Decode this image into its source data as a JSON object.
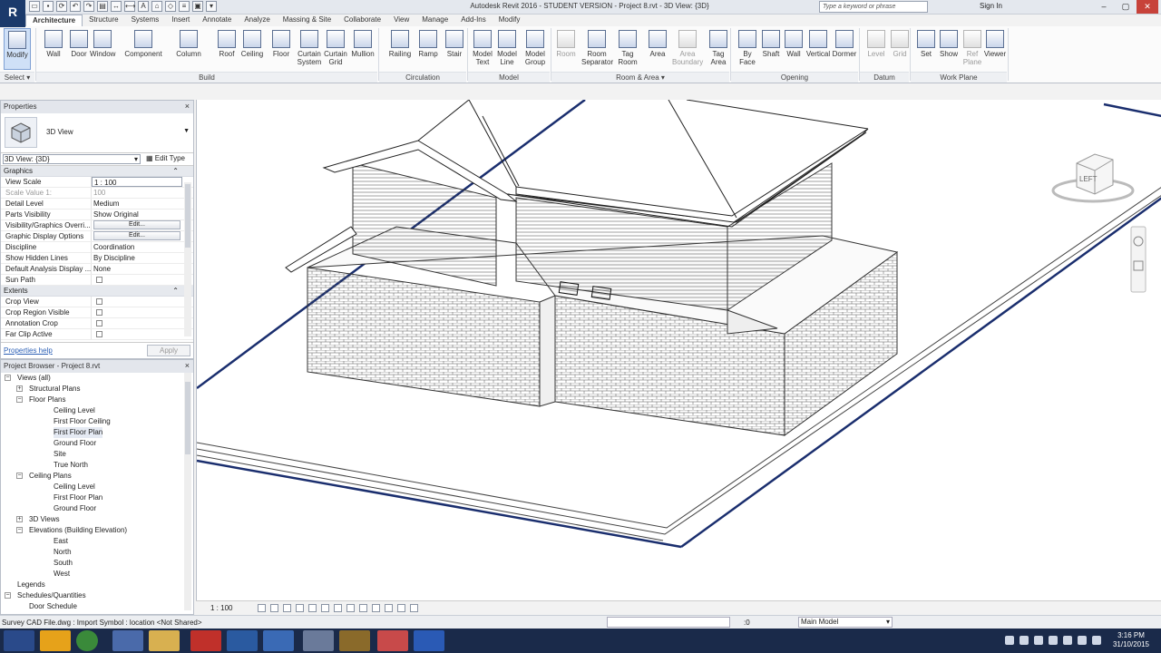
{
  "title": {
    "app_title": "Autodesk Revit 2016 - STUDENT VERSION - Project 8.rvt - 3D View: {3D}",
    "logo": "R",
    "search_placeholder": "Type a keyword or phrase",
    "sign_in": "Sign In"
  },
  "tabs": [
    "Architecture",
    "Structure",
    "Systems",
    "Insert",
    "Annotate",
    "Analyze",
    "Massing & Site",
    "Collaborate",
    "View",
    "Manage",
    "Add-Ins",
    "Modify"
  ],
  "ribbon": {
    "buttons": [
      {
        "id": "modify",
        "l1": "Modify",
        "l2": ""
      },
      {
        "id": "wall",
        "l1": "Wall",
        "l2": ""
      },
      {
        "id": "door",
        "l1": "Door",
        "l2": ""
      },
      {
        "id": "window",
        "l1": "Window",
        "l2": ""
      },
      {
        "id": "component",
        "l1": "Component",
        "l2": ""
      },
      {
        "id": "column",
        "l1": "Column",
        "l2": ""
      },
      {
        "id": "roof",
        "l1": "Roof",
        "l2": ""
      },
      {
        "id": "ceiling",
        "l1": "Ceiling",
        "l2": ""
      },
      {
        "id": "floor",
        "l1": "Floor",
        "l2": ""
      },
      {
        "id": "curtain-system",
        "l1": "Curtain",
        "l2": "System"
      },
      {
        "id": "curtain-grid",
        "l1": "Curtain",
        "l2": "Grid"
      },
      {
        "id": "mullion",
        "l1": "Mullion",
        "l2": ""
      },
      {
        "id": "railing",
        "l1": "Railing",
        "l2": ""
      },
      {
        "id": "ramp",
        "l1": "Ramp",
        "l2": ""
      },
      {
        "id": "stair",
        "l1": "Stair",
        "l2": ""
      },
      {
        "id": "model-text",
        "l1": "Model",
        "l2": "Text"
      },
      {
        "id": "model-line",
        "l1": "Model",
        "l2": "Line"
      },
      {
        "id": "model-group",
        "l1": "Model",
        "l2": "Group"
      },
      {
        "id": "room",
        "l1": "Room",
        "l2": ""
      },
      {
        "id": "room-separator",
        "l1": "Room",
        "l2": "Separator"
      },
      {
        "id": "tag-room",
        "l1": "Tag",
        "l2": "Room"
      },
      {
        "id": "area",
        "l1": "Area",
        "l2": ""
      },
      {
        "id": "area-boundary",
        "l1": "Area",
        "l2": "Boundary"
      },
      {
        "id": "tag-area",
        "l1": "Tag",
        "l2": "Area"
      },
      {
        "id": "by-face",
        "l1": "By",
        "l2": "Face"
      },
      {
        "id": "shaft",
        "l1": "Shaft",
        "l2": ""
      },
      {
        "id": "wall-opening",
        "l1": "Wall",
        "l2": ""
      },
      {
        "id": "vertical",
        "l1": "Vertical",
        "l2": ""
      },
      {
        "id": "dormer",
        "l1": "Dormer",
        "l2": ""
      },
      {
        "id": "level",
        "l1": "Level",
        "l2": ""
      },
      {
        "id": "grid",
        "l1": "Grid",
        "l2": ""
      },
      {
        "id": "set",
        "l1": "Set",
        "l2": ""
      },
      {
        "id": "show",
        "l1": "Show",
        "l2": ""
      },
      {
        "id": "ref-plane",
        "l1": "Ref",
        "l2": "Plane"
      },
      {
        "id": "viewer",
        "l1": "Viewer",
        "l2": ""
      }
    ],
    "panels": {
      "select": "Select ▾",
      "build": "Build",
      "circulation": "Circulation",
      "model": "Model",
      "room_area": "Room & Area ▾",
      "opening": "Opening",
      "datum": "Datum",
      "work_plane": "Work Plane"
    }
  },
  "properties": {
    "header": "Properties",
    "close": "×",
    "type_name": "3D View",
    "view_selector": "3D View: {3D}",
    "edit_type": "Edit Type",
    "groups": {
      "graphics": "Graphics",
      "extents": "Extents"
    },
    "rows": [
      {
        "k": "View Scale",
        "v": "1 : 100",
        "kind": "input"
      },
      {
        "k": "Scale Value    1:",
        "v": "100",
        "kind": "disabled"
      },
      {
        "k": "Detail Level",
        "v": "Medium",
        "kind": "text"
      },
      {
        "k": "Parts Visibility",
        "v": "Show Original",
        "kind": "text"
      },
      {
        "k": "Visibility/Graphics Overri...",
        "v": "Edit...",
        "kind": "button"
      },
      {
        "k": "Graphic Display Options",
        "v": "Edit...",
        "kind": "button"
      },
      {
        "k": "Discipline",
        "v": "Coordination",
        "kind": "text"
      },
      {
        "k": "Show Hidden Lines",
        "v": "By Discipline",
        "kind": "text"
      },
      {
        "k": "Default Analysis Display ...",
        "v": "None",
        "kind": "text"
      },
      {
        "k": "Sun Path",
        "v": "",
        "kind": "check"
      }
    ],
    "extents_rows": [
      {
        "k": "Crop View",
        "v": "",
        "kind": "check"
      },
      {
        "k": "Crop Region Visible",
        "v": "",
        "kind": "check"
      },
      {
        "k": "Annotation Crop",
        "v": "",
        "kind": "check"
      },
      {
        "k": "Far Clip Active",
        "v": "",
        "kind": "check"
      }
    ],
    "help_link": "Properties help",
    "apply": "Apply"
  },
  "browser": {
    "header": "Project Browser - Project 8.rvt",
    "close": "×",
    "items": [
      {
        "label": "Views (all)",
        "level": 0,
        "toggle": "−"
      },
      {
        "label": "Structural Plans",
        "level": 1,
        "toggle": "+"
      },
      {
        "label": "Floor Plans",
        "level": 1,
        "toggle": "−"
      },
      {
        "label": "Ceiling Level",
        "level": 2,
        "toggle": ""
      },
      {
        "label": "First Floor Ceiling",
        "level": 2,
        "toggle": ""
      },
      {
        "label": "First Floor Plan",
        "level": 2,
        "toggle": "",
        "selected": true
      },
      {
        "label": "Ground Floor",
        "level": 2,
        "toggle": ""
      },
      {
        "label": "Site",
        "level": 2,
        "toggle": ""
      },
      {
        "label": "True North",
        "level": 2,
        "toggle": ""
      },
      {
        "label": "Ceiling Plans",
        "level": 1,
        "toggle": "−"
      },
      {
        "label": "Ceiling Level",
        "level": 2,
        "toggle": ""
      },
      {
        "label": "First Floor Plan",
        "level": 2,
        "toggle": ""
      },
      {
        "label": "Ground Floor",
        "level": 2,
        "toggle": ""
      },
      {
        "label": "3D Views",
        "level": 1,
        "toggle": "+"
      },
      {
        "label": "Elevations (Building Elevation)",
        "level": 1,
        "toggle": "−"
      },
      {
        "label": "East",
        "level": 2,
        "toggle": ""
      },
      {
        "label": "North",
        "level": 2,
        "toggle": ""
      },
      {
        "label": "South",
        "level": 2,
        "toggle": ""
      },
      {
        "label": "West",
        "level": 2,
        "toggle": ""
      },
      {
        "label": "Legends",
        "level": 0,
        "toggle": ""
      },
      {
        "label": "Schedules/Quantities",
        "level": 0,
        "toggle": "−"
      },
      {
        "label": "Door Schedule",
        "level": 1,
        "toggle": ""
      }
    ]
  },
  "viewcube": {
    "face": "LEFT"
  },
  "viewbar": {
    "scale": "1 : 100"
  },
  "status": {
    "message": "Survey CAD File.dwg : Import Symbol : location <Not Shared>",
    "zero": ":0",
    "model": "Main Model"
  },
  "clock": {
    "time": "3:16 PM",
    "date": "31/10/2015"
  },
  "colors": {
    "accent": "#1b3a6b",
    "site_line": "#1a2e6e",
    "selected_tab": "#ffffff"
  }
}
